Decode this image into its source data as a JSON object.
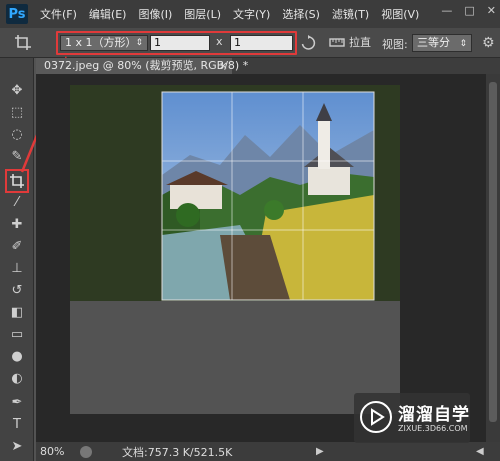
{
  "app": {
    "logo": "Ps"
  },
  "menu": [
    "文件(F)",
    "编辑(E)",
    "图像(I)",
    "图层(L)",
    "文字(Y)",
    "选择(S)",
    "滤镜(T)",
    "视图(V)"
  ],
  "window_controls": {
    "minimize": "—",
    "restore": "□",
    "close": "✕"
  },
  "options": {
    "ratio_select": "1 x 1（方形）",
    "width_value": "1",
    "separator": "x",
    "height_value": "1",
    "straighten_label": "拉直",
    "view_label": "视图:",
    "view_select": "三等分"
  },
  "tab": {
    "title": "0372.jpeg @ 80% (裁剪预览, RGB/8) *",
    "close": "×"
  },
  "status": {
    "zoom": "80%",
    "doc_info": "文档:757.3 K/521.5K"
  },
  "watermark": {
    "title": "溜溜自学",
    "url": "ZIXUE.3D66.COM"
  },
  "colors": {
    "highlight": "#e03a3a",
    "menubar": "#3c3c3c",
    "panel": "#434343",
    "canvas": "#282828"
  },
  "icons": [
    "crop-icon",
    "swap-icon",
    "straighten-icon",
    "gear-icon",
    "move-icon",
    "marquee-icon",
    "lasso-icon",
    "quick-select-icon",
    "eyedropper-icon",
    "healing-icon",
    "brush-icon",
    "stamp-icon",
    "history-brush-icon",
    "eraser-icon",
    "gradient-icon",
    "blur-icon",
    "dodge-icon",
    "pen-icon",
    "type-icon",
    "path-select-icon"
  ]
}
